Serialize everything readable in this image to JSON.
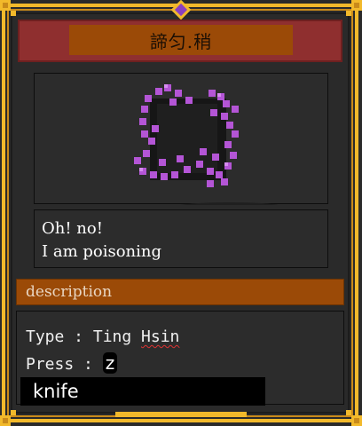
{
  "card": {
    "title": "諦匀.稍",
    "message_line1": "Oh! no!",
    "message_line2": "I am poisoning",
    "description_header": "description",
    "type_prefix": "Type : ",
    "type_value": "Ting Hsin",
    "press_prefix": "Press : ",
    "press_key": "z",
    "item_name": "knife"
  },
  "colors": {
    "gold": "#f2b92b",
    "banner_red": "#8f2f2f",
    "orange": "#9b4a07",
    "panel": "#2c2c2c",
    "sprite_purple": "#b455d6"
  },
  "icons": {
    "top_gem": "diamond-gem-icon",
    "sprite": "poison-sprite-icon"
  }
}
